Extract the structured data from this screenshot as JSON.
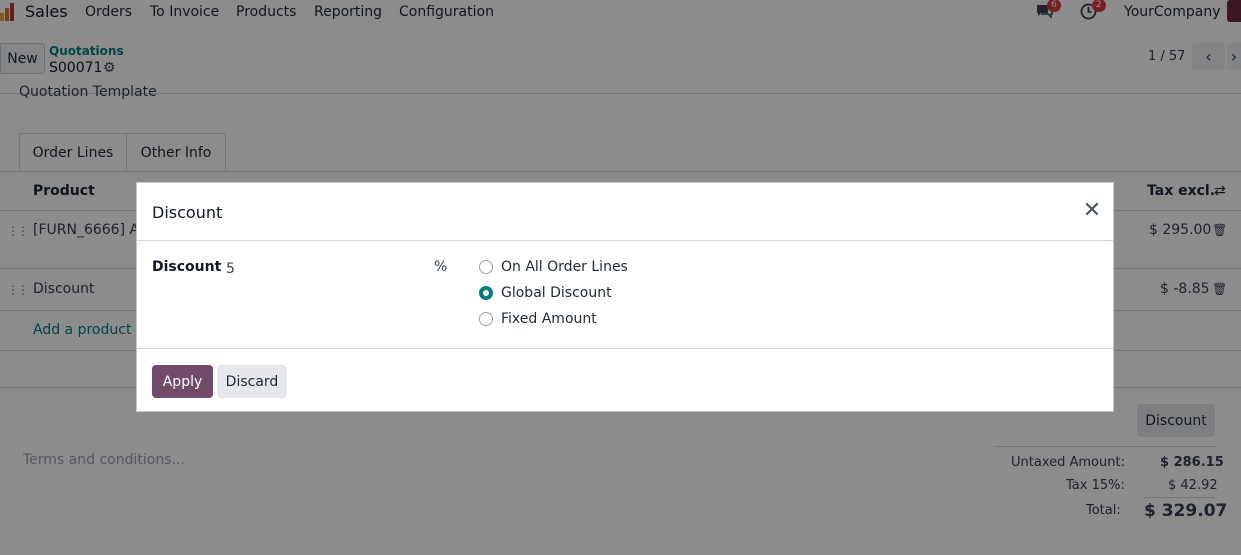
{
  "topnav": {
    "brand": "Sales",
    "menu": [
      "Orders",
      "To Invoice",
      "Products",
      "Reporting",
      "Configuration"
    ],
    "messages_badge": "6",
    "activities_badge": "2",
    "company": "YourCompany"
  },
  "control_panel": {
    "new_label": "New",
    "breadcrumb": "Quotations",
    "record": "S00071",
    "pager": "1 / 57"
  },
  "form": {
    "quotation_template_label": "Quotation Template",
    "tabs": [
      "Order Lines",
      "Other Info"
    ],
    "columns": {
      "product": "Product",
      "tax_excl": "Tax excl."
    },
    "lines": [
      {
        "product": "[FURN_6666] Ac",
        "amount": "$ 295.00"
      },
      {
        "product": "Discount",
        "amount": "$ -8.85"
      }
    ],
    "add_product": "Add a product",
    "terms_placeholder": "Terms and conditions...",
    "discount_button": "Discount",
    "totals": {
      "untaxed_label": "Untaxed Amount:",
      "untaxed_value": "$ 286.15",
      "tax_label": "Tax 15%:",
      "tax_value": "$ 42.92",
      "total_label": "Total:",
      "total_value": "$ 329.07"
    }
  },
  "dialog": {
    "title": "Discount",
    "field_label": "Discount",
    "field_value": "5",
    "unit": "%",
    "options": [
      {
        "label": "On All Order Lines",
        "checked": false
      },
      {
        "label": "Global Discount",
        "checked": true
      },
      {
        "label": "Fixed Amount",
        "checked": false
      }
    ],
    "apply_label": "Apply",
    "discard_label": "Discard"
  }
}
